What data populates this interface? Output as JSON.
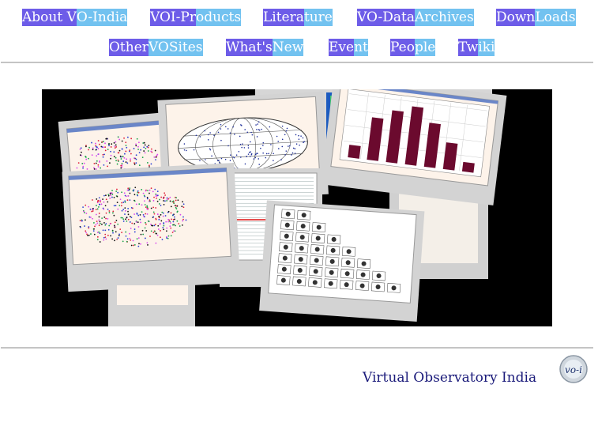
{
  "nav": {
    "row1": [
      {
        "parts": [
          "About V",
          "O-India"
        ]
      },
      {
        "parts": [
          "VOI-Pr",
          "oducts"
        ]
      },
      {
        "parts": [
          "Litera",
          "ture"
        ]
      },
      {
        "parts": [
          "VO-Data",
          "Archives"
        ]
      },
      {
        "parts": [
          "Down",
          "Loads"
        ]
      }
    ],
    "row2": [
      {
        "parts": [
          "Other",
          "VOSites"
        ]
      },
      {
        "parts": [
          "What's ",
          "New"
        ]
      },
      {
        "parts": [
          "Eve",
          "nt"
        ]
      },
      {
        "parts": [
          "Peo",
          "ple"
        ]
      },
      {
        "parts": [
          "Tw",
          "iki"
        ]
      }
    ]
  },
  "banner": {
    "bar_chart": {
      "values": [
        8,
        27,
        33,
        37,
        28,
        17,
        6
      ]
    }
  },
  "footer": {
    "title": "Virtual Observatory India",
    "logo_text": "vo-i"
  },
  "colors": {
    "nav_purple": "#6d5ce8",
    "nav_blue": "#72c2f0",
    "footer_text": "#1a1a7a",
    "bar_color": "#6b0a2e"
  }
}
